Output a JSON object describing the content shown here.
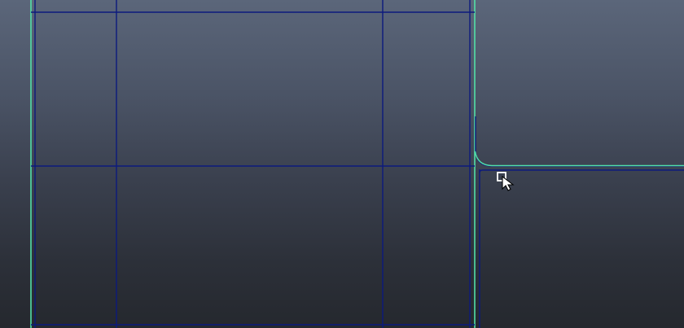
{
  "viewport": {
    "background_top": "#5b667a",
    "background_bottom": "#25282e",
    "wire_color": "#0c1a7e",
    "highlight_color": "#52e0a8"
  },
  "cursor": {
    "icon": "select-cursor-icon"
  }
}
